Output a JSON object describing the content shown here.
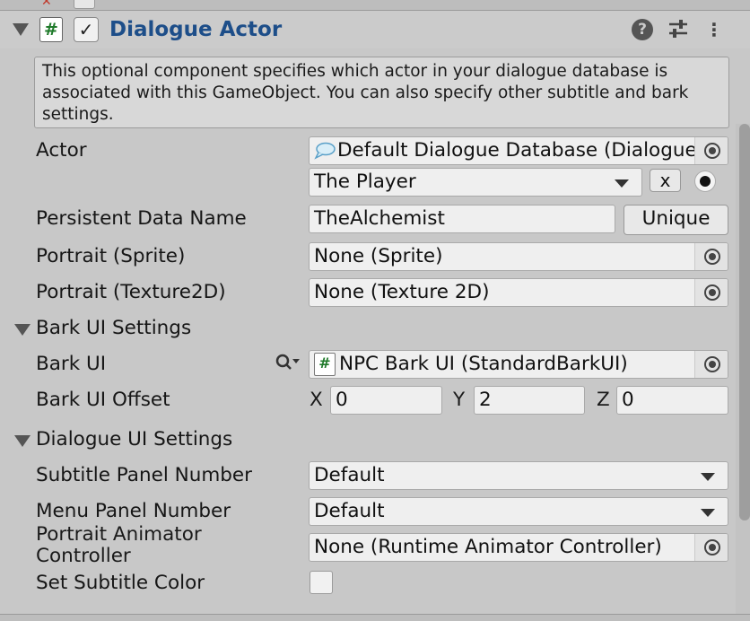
{
  "component": {
    "title": "Dialogue Actor",
    "script_icon": "#",
    "enabled_check": "✓"
  },
  "header_icons": {
    "help": "?",
    "presets": "⇅",
    "menu": "⋮"
  },
  "help_text": "This optional component specifies which actor in your dialogue database is associated with this GameObject. You can also specify other subtitle and bark settings.",
  "actor": {
    "label": "Actor",
    "database_value": "Default Dialogue Database (Dialogue",
    "actor_value": "The Player",
    "clear_label": "x"
  },
  "persistent": {
    "label": "Persistent Data Name",
    "value": "TheAlchemist",
    "button": "Unique"
  },
  "portrait_sprite": {
    "label": "Portrait (Sprite)",
    "value": "None (Sprite)"
  },
  "portrait_texture": {
    "label": "Portrait (Texture2D)",
    "value": "None (Texture 2D)"
  },
  "bark_section": {
    "label": "Bark UI Settings",
    "bark_ui_label": "Bark UI",
    "bark_ui_value": "NPC Bark UI (StandardBarkUI)",
    "offset_label": "Bark UI Offset",
    "x_label": "X",
    "x_value": "0",
    "y_label": "Y",
    "y_value": "2",
    "z_label": "Z",
    "z_value": "0"
  },
  "dialogue_section": {
    "label": "Dialogue UI Settings",
    "subtitle_panel_label": "Subtitle Panel Number",
    "subtitle_panel_value": "Default",
    "menu_panel_label": "Menu Panel Number",
    "menu_panel_value": "Default",
    "portrait_animator_label_1": "Portrait Animator",
    "portrait_animator_label_2": "Controller",
    "portrait_animator_value": "None (Runtime Animator Controller)",
    "subtitle_color_label": "Set Subtitle Color"
  }
}
